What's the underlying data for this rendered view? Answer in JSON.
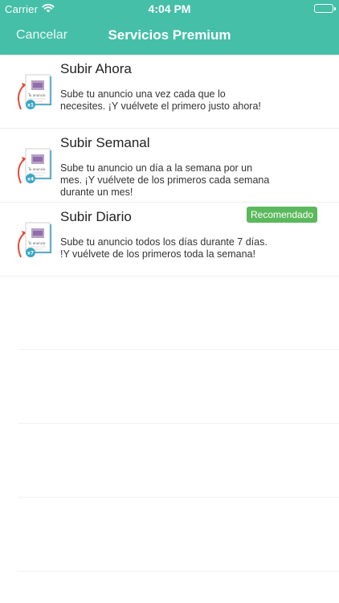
{
  "status_bar": {
    "carrier": "Carrier",
    "time": "4:04 PM"
  },
  "nav": {
    "cancel_label": "Cancelar",
    "title": "Servicios Premium"
  },
  "services": [
    {
      "title": "Subir Ahora",
      "description": "Sube tu anuncio una vez cada que lo necesites. ¡Y vuélvete el primero justo ahora!",
      "multiplier": "x1"
    },
    {
      "title": "Subir Semanal",
      "description": "Sube tu anuncio un día a la semana por un mes. ¡Y vuélvete de los primeros cada semana durante un mes!",
      "multiplier": "x4"
    },
    {
      "title": "Subir Diario",
      "description": "Sube tu anuncio todos los días durante 7 días. !Y vuélvete de los primeros toda la semana!",
      "multiplier": "x7",
      "badge": "Recomendado"
    }
  ],
  "icon_caption": "Tu anuncio",
  "colors": {
    "header": "#45bfa8",
    "badge": "#5cb85c",
    "arrow": "#e74c3c",
    "book": "#3aa6c4"
  }
}
